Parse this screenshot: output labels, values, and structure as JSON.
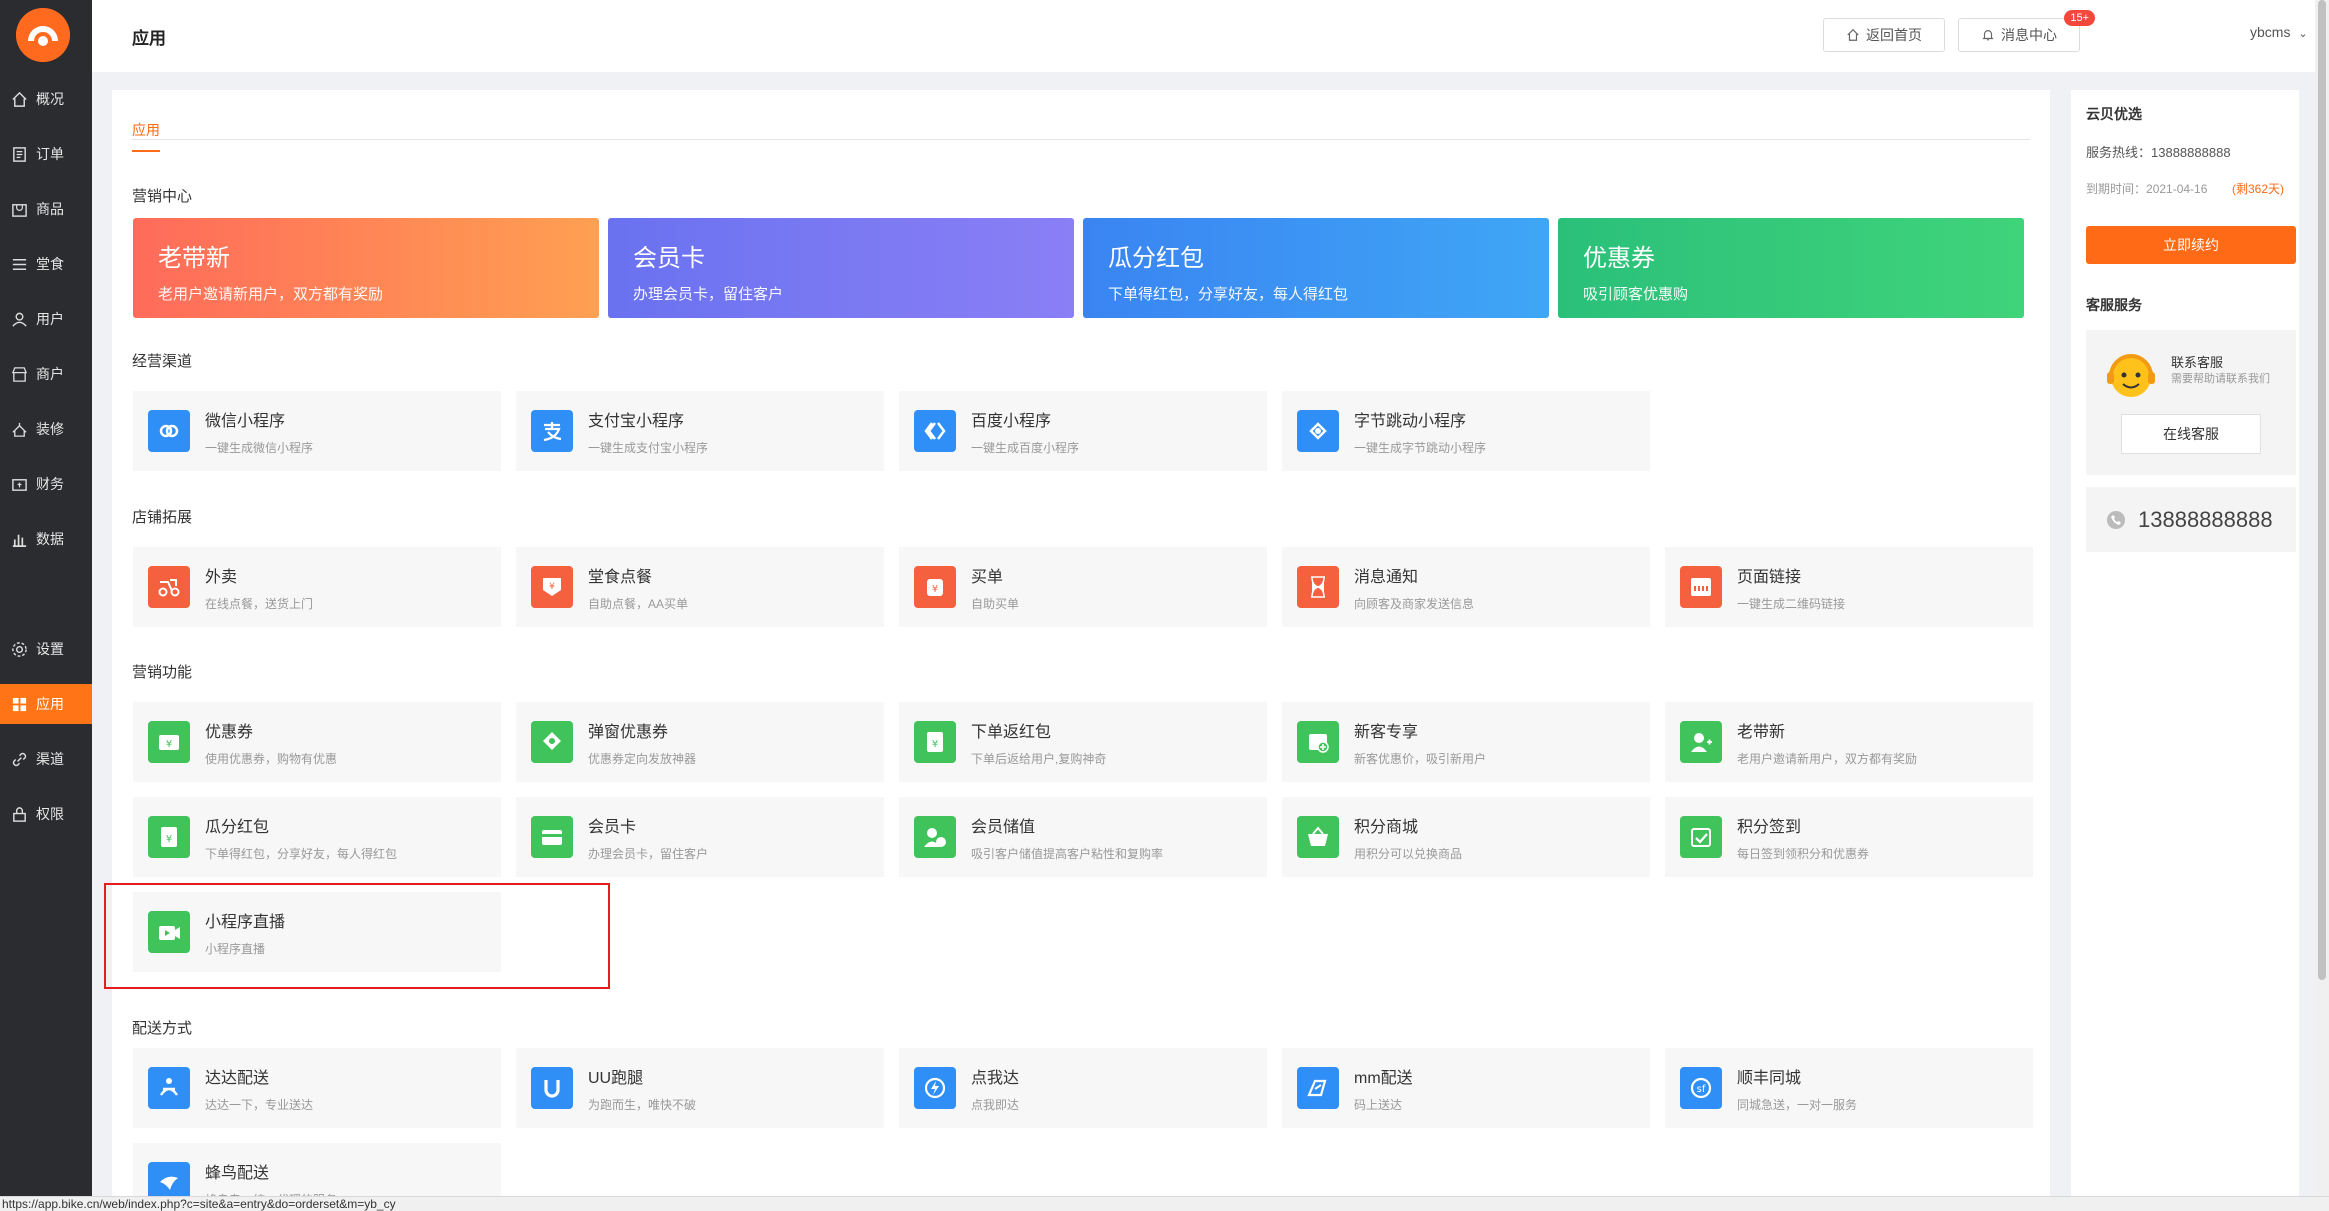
{
  "sidebar": {
    "items": [
      {
        "label": "概况",
        "icon": "home-icon"
      },
      {
        "label": "订单",
        "icon": "order-icon"
      },
      {
        "label": "商品",
        "icon": "goods-icon"
      },
      {
        "label": "堂食",
        "icon": "menu-icon"
      },
      {
        "label": "用户",
        "icon": "user-icon"
      },
      {
        "label": "商户",
        "icon": "shop-icon"
      },
      {
        "label": "装修",
        "icon": "decorate-icon"
      },
      {
        "label": "财务",
        "icon": "finance-icon"
      },
      {
        "label": "数据",
        "icon": "chart-icon"
      },
      {
        "label": "设置",
        "icon": "settings-icon"
      },
      {
        "label": "应用",
        "icon": "apps-icon"
      },
      {
        "label": "渠道",
        "icon": "channel-icon"
      },
      {
        "label": "权限",
        "icon": "lock-icon"
      }
    ],
    "active_index": 10
  },
  "header": {
    "title": "应用",
    "home_btn": "返回首页",
    "msg_btn": "消息中心",
    "msg_badge": "15+",
    "user": "ybcms"
  },
  "main": {
    "tab": "应用",
    "section_marketing_center": "营销中心",
    "banners": [
      {
        "title": "老带新",
        "subtitle": "老用户邀请新用户，双方都有奖励",
        "color_from": "#ff6b5a",
        "color_to": "#ffa052"
      },
      {
        "title": "会员卡",
        "subtitle": "办理会员卡，留住客户",
        "color_from": "#6a72f0",
        "color_to": "#8a7ff5"
      },
      {
        "title": "瓜分红包",
        "subtitle": "下单得红包，分享好友，每人得红包",
        "color_from": "#3a84f2",
        "color_to": "#3fa6f5"
      },
      {
        "title": "优惠券",
        "subtitle": "吸引顾客优惠购",
        "color_from": "#2bc07a",
        "color_to": "#3fd47a"
      }
    ],
    "sections": [
      {
        "title": "经营渠道",
        "apps": [
          {
            "title": "微信小程序",
            "sub": "一键生成微信小程序",
            "color": "#2f8ff7",
            "icon": "wechat-miniprogram-icon"
          },
          {
            "title": "支付宝小程序",
            "sub": "一键生成支付宝小程序",
            "color": "#2f8ff7",
            "icon": "alipay-icon"
          },
          {
            "title": "百度小程序",
            "sub": "一键生成百度小程序",
            "color": "#2f8ff7",
            "icon": "baidu-icon"
          },
          {
            "title": "字节跳动小程序",
            "sub": "一键生成字节跳动小程序",
            "color": "#2f8ff7",
            "icon": "bytedance-icon"
          }
        ]
      },
      {
        "title": "店铺拓展",
        "apps": [
          {
            "title": "外卖",
            "sub": "在线点餐，送货上门",
            "color": "#f5603f",
            "icon": "scooter-icon"
          },
          {
            "title": "堂食点餐",
            "sub": "自助点餐，AA买单",
            "color": "#f5603f",
            "icon": "dine-in-icon"
          },
          {
            "title": "买单",
            "sub": "自助买单",
            "color": "#f5603f",
            "icon": "pay-bill-icon"
          },
          {
            "title": "消息通知",
            "sub": "向顾客及商家发送信息",
            "color": "#f5603f",
            "icon": "hourglass-icon"
          },
          {
            "title": "页面链接",
            "sub": "一键生成二维码链接",
            "color": "#f5603f",
            "icon": "link-icon"
          }
        ]
      },
      {
        "title": "营销功能",
        "apps": [
          {
            "title": "优惠券",
            "sub": "使用优惠券，购物有优惠",
            "color": "#3fc35a",
            "icon": "coupon-icon"
          },
          {
            "title": "弹窗优惠券",
            "sub": "优惠券定向发放神器",
            "color": "#3fc35a",
            "icon": "popup-coupon-icon"
          },
          {
            "title": "下单返红包",
            "sub": "下单后返给用户,复购神奇",
            "color": "#3fc35a",
            "icon": "red-packet-icon"
          },
          {
            "title": "新客专享",
            "sub": "新客优惠价，吸引新用户",
            "color": "#3fc35a",
            "icon": "new-customer-icon"
          },
          {
            "title": "老带新",
            "sub": "老用户邀请新用户，双方都有奖励",
            "color": "#3fc35a",
            "icon": "invite-icon"
          },
          {
            "title": "瓜分红包",
            "sub": "下单得红包，分享好友，每人得红包",
            "color": "#3fc35a",
            "icon": "split-packet-icon"
          },
          {
            "title": "会员卡",
            "sub": "办理会员卡，留住客户",
            "color": "#3fc35a",
            "icon": "member-card-icon"
          },
          {
            "title": "会员储值",
            "sub": "吸引客户储值提高客户粘性和复购率",
            "color": "#3fc35a",
            "icon": "member-deposit-icon"
          },
          {
            "title": "积分商城",
            "sub": "用积分可以兑换商品",
            "color": "#3fc35a",
            "icon": "points-mall-icon"
          },
          {
            "title": "积分签到",
            "sub": "每日签到领积分和优惠券",
            "color": "#3fc35a",
            "icon": "checkin-icon"
          },
          {
            "title": "小程序直播",
            "sub": "小程序直播",
            "color": "#3fc35a",
            "icon": "live-video-icon"
          }
        ]
      },
      {
        "title": "配送方式",
        "apps": [
          {
            "title": "达达配送",
            "sub": "达达一下，专业送达",
            "color": "#2f8ff7",
            "icon": "dada-icon"
          },
          {
            "title": "UU跑腿",
            "sub": "为跑而生，唯快不破",
            "color": "#2f8ff7",
            "icon": "uu-icon"
          },
          {
            "title": "点我达",
            "sub": "点我即达",
            "color": "#2f8ff7",
            "icon": "dianwoda-icon"
          },
          {
            "title": "mm配送",
            "sub": "码上送达",
            "color": "#2f8ff7",
            "icon": "mm-icon"
          },
          {
            "title": "顺丰同城",
            "sub": "同城急送，一对一服务",
            "color": "#2f8ff7",
            "icon": "sf-icon"
          },
          {
            "title": "蜂鸟配送",
            "sub": "蜂鸟专，统一代理的服务",
            "color": "#2f8ff7",
            "icon": "bird-icon"
          }
        ]
      }
    ]
  },
  "right_panel": {
    "store_name": "云贝优选",
    "hotline_label": "服务热线：",
    "hotline": "13888888888",
    "expire_label": "到期时间：",
    "expire_date": "2021-04-16",
    "days_left": "(剩362天)",
    "renew_btn": "立即续约",
    "cs_title": "客服服务",
    "cs_name": "联系客服",
    "cs_desc": "需要帮助请联系我们",
    "cs_online_btn": "在线客服",
    "cs_phone": "13888888888"
  },
  "status_url": "https://app.bike.cn/web/index.php?c=site&a=entry&do=orderset&m=yb_cy"
}
